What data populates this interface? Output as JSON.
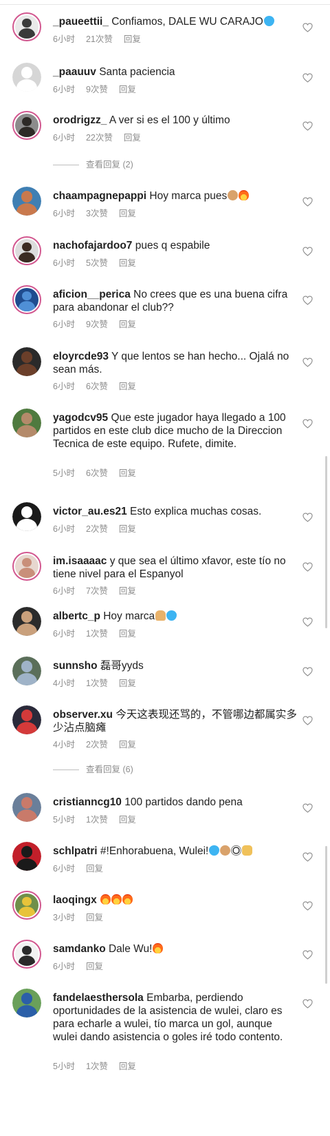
{
  "comments": [
    {
      "user": "_paueettii_",
      "text": "Confiamos, DALE WU CARAJO",
      "emojis": [
        "blueheart"
      ],
      "time": "6小时",
      "likes": "21次赞",
      "reply": "回复",
      "avatar_colors": [
        "#3a3a3a",
        "#e9e9e9"
      ],
      "story": true
    },
    {
      "user": "_paauuv",
      "text": "Santa paciencia",
      "emojis": [],
      "time": "6小时",
      "likes": "9次赞",
      "reply": "回复",
      "avatar_colors": [
        "#ffffff",
        "#d6d6d6"
      ],
      "story": false
    },
    {
      "user": "orodrigzz_",
      "text": "A ver si es el 100 y último",
      "emojis": [],
      "time": "6小时",
      "likes": "22次赞",
      "reply": "回复",
      "avatar_colors": [
        "#2d2a26",
        "#8c8c8c"
      ],
      "story": true
    },
    {
      "user": "chaampagnepappi",
      "text": "Hoy marca pues",
      "emojis": [
        "arm",
        "fire"
      ],
      "time": "6小时",
      "likes": "3次赞",
      "reply": "回复",
      "avatar_colors": [
        "#c9794d",
        "#3f7fb3"
      ],
      "story": false
    },
    {
      "user": "nachofajardoo7",
      "text": "pues q espabile",
      "emojis": [],
      "time": "6小时",
      "likes": "5次赞",
      "reply": "回复",
      "avatar_colors": [
        "#3b2b22",
        "#dcdcdc"
      ],
      "story": true
    },
    {
      "user": "aficion__perica",
      "text": "No crees que es una buena cifra para abandonar el club??",
      "emojis": [],
      "time": "6小时",
      "likes": "9次赞",
      "reply": "回复",
      "avatar_colors": [
        "#4f8fd6",
        "#1f4c8f"
      ],
      "story": true
    },
    {
      "user": "eloyrcde93",
      "text": "Y que lentos se han hecho... Ojalá no sean más.",
      "emojis": [],
      "time": "6小时",
      "likes": "6次赞",
      "reply": "回复",
      "avatar_colors": [
        "#6b3f2a",
        "#2a2a2a"
      ],
      "story": false
    },
    {
      "user": "yagodcv95",
      "text": "Que este jugador haya llegado a 100 partidos en este club dice mucho de la Direccion Tecnica de este equipo. Rufete, dimite.",
      "emojis": [],
      "time": "5小时",
      "likes": "6次赞",
      "reply": "回复",
      "avatar_colors": [
        "#b48a6a",
        "#4f7a3f"
      ],
      "story": false
    },
    {
      "user": "victor_au.es21",
      "text": "Esto explica muchas cosas.",
      "emojis": [],
      "time": "6小时",
      "likes": "2次赞",
      "reply": "回复",
      "avatar_colors": [
        "#ffffff",
        "#1a1a1a"
      ],
      "story": false
    },
    {
      "user": "im.isaaaac",
      "text": "y que sea el último xfavor, este tío no tiene nivel para el Espanyol",
      "emojis": [],
      "time": "6小时",
      "likes": "7次赞",
      "reply": "回复",
      "avatar_colors": [
        "#c98f7a",
        "#e7d7cf"
      ],
      "story": true
    },
    {
      "user": "albertc_p",
      "text": "Hoy marca",
      "emojis": [
        "pray",
        "blueheart"
      ],
      "time": "6小时",
      "likes": "1次赞",
      "reply": "回复",
      "avatar_colors": [
        "#c9a07c",
        "#2b2b2b"
      ],
      "story": false
    },
    {
      "user": "sunnsho",
      "text": "磊哥yyds",
      "emojis": [],
      "time": "4小时",
      "likes": "1次赞",
      "reply": "回复",
      "avatar_colors": [
        "#9fb3c8",
        "#5b6f5a"
      ],
      "story": false
    },
    {
      "user": "observer.xu",
      "text": "今天这表现还骂的，不管哪边都属实多少沾点脑瘫",
      "emojis": [],
      "time": "4小时",
      "likes": "2次赞",
      "reply": "回复",
      "avatar_colors": [
        "#d43a3a",
        "#2a2a3a"
      ],
      "story": false
    },
    {
      "user": "cristianncg10",
      "text": "100 partidos dando pena",
      "emojis": [],
      "time": "5小时",
      "likes": "1次赞",
      "reply": "回复",
      "avatar_colors": [
        "#c97a6a",
        "#6a7f9a"
      ],
      "story": false
    },
    {
      "user": "schlpatri",
      "text": "#!Enhorabuena, Wulei!",
      "emojis": [
        "blueheart",
        "arm",
        "ball",
        "hands"
      ],
      "time": "6小时",
      "likes": "",
      "reply": "回复",
      "avatar_colors": [
        "#1a1a1a",
        "#c21f2a"
      ],
      "story": false
    },
    {
      "user": "laoqingx",
      "text": "",
      "emojis": [
        "fire",
        "fire",
        "fire"
      ],
      "time": "3小时",
      "likes": "",
      "reply": "回复",
      "avatar_colors": [
        "#e8c33a",
        "#6f8f4a"
      ],
      "story": true
    },
    {
      "user": "samdanko",
      "text": "Dale Wu!",
      "emojis": [
        "fire"
      ],
      "time": "6小时",
      "likes": "",
      "reply": "回复",
      "avatar_colors": [
        "#2a2a2a",
        "#f2f2f2"
      ],
      "story": true
    },
    {
      "user": "fandelaesthersola",
      "text": "Embarba, perdiendo oportunidades de la asistencia de wulei, claro es para echarle a wulei, tío marca un gol, aunque wulei dando asistencia o goles iré todo contento.",
      "emojis": [],
      "time": "5小时",
      "likes": "1次赞",
      "reply": "回复",
      "avatar_colors": [
        "#2b5fa8",
        "#6aa05a"
      ],
      "story": false
    }
  ],
  "view_replies": [
    "查看回复 (2)",
    "查看回复 (6)"
  ]
}
